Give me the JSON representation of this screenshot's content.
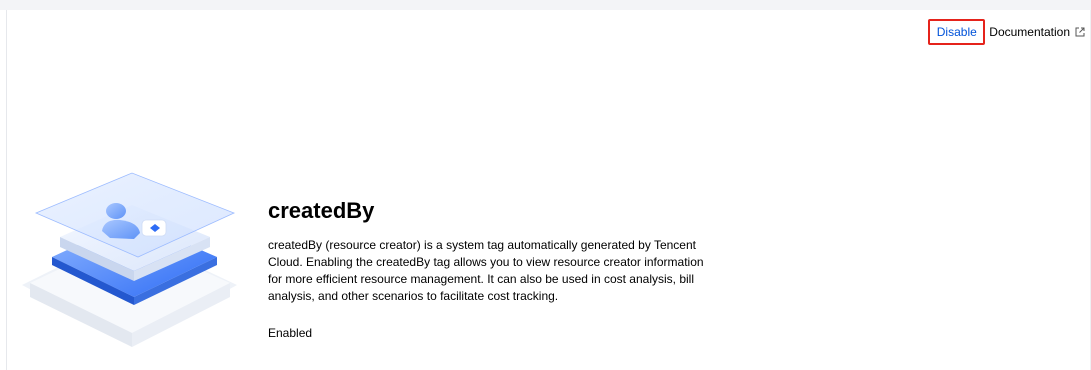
{
  "header": {
    "disable_label": "Disable",
    "documentation_label": "Documentation"
  },
  "feature": {
    "title": "createdBy",
    "description": "createdBy (resource creator) is a system tag automatically generated by Tencent Cloud. Enabling the createdBy tag allows you to view resource creator information for more efficient resource management. It can also be used in cost analysis, bill analysis, and other scenarios to facilitate cost tracking.",
    "status": "Enabled"
  },
  "icons": {
    "documentation": "external-link-icon",
    "illustration": "user-tag-illustration"
  },
  "colors": {
    "link": "#0052d9",
    "highlight_border": "#e5231b",
    "illustration_accent": "#3d7bff"
  }
}
